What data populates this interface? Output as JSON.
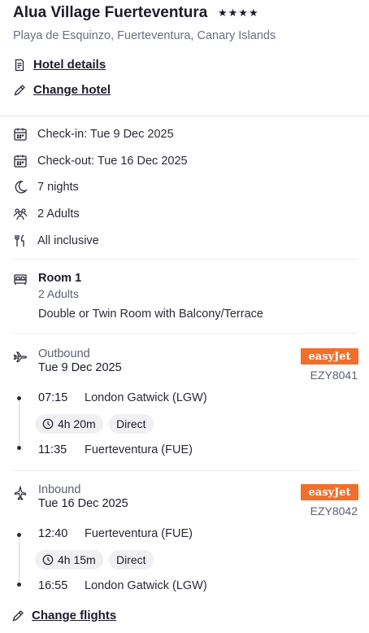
{
  "hotel": {
    "name": "Alua Village Fuerteventura",
    "stars": "★★★★",
    "location": "Playa de Esquinzo, Fuerteventura, Canary Islands",
    "details_link": "Hotel details",
    "change_hotel_link": "Change hotel"
  },
  "stay": {
    "checkin": "Check-in: Tue 9 Dec 2025",
    "checkout": "Check-out: Tue 16 Dec 2025",
    "nights": "7 nights",
    "guests": "2 Adults",
    "board": "All inclusive"
  },
  "room": {
    "title": "Room 1",
    "guests": "2 Adults",
    "description": "Double or Twin Room with Balcony/Terrace"
  },
  "outbound": {
    "label": "Outbound",
    "date": "Tue 9 Dec 2025",
    "airline": "easyJet",
    "flight_number": "EZY8041",
    "depart_time": "07:15",
    "depart_airport": "London Gatwick (LGW)",
    "duration": "4h 20m",
    "stops": "Direct",
    "arrive_time": "11:35",
    "arrive_airport": "Fuerteventura (FUE)"
  },
  "inbound": {
    "label": "Inbound",
    "date": "Tue 16 Dec 2025",
    "airline": "easyJet",
    "flight_number": "EZY8042",
    "depart_time": "12:40",
    "depart_airport": "Fuerteventura (FUE)",
    "duration": "4h 15m",
    "stops": "Direct",
    "arrive_time": "16:55",
    "arrive_airport": "London Gatwick (LGW)"
  },
  "change_flights_link": "Change flights",
  "colors": {
    "brand_easyjet": "#f0702b",
    "text": "#1b1b2a",
    "muted": "#6b6f80"
  }
}
